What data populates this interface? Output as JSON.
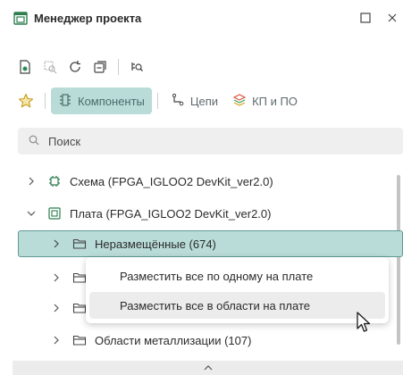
{
  "window": {
    "title": "Менеджер проекта",
    "title_icon": "project-manager-icon",
    "maximize_icon": "maximize-icon",
    "close_icon": "close-icon"
  },
  "toolbar": {
    "icons": [
      "document-settings-icon",
      "select-area-icon",
      "refresh-icon",
      "collapse-all-icon",
      "find-icon"
    ]
  },
  "tabs": {
    "favorites_icon": "star-icon",
    "items": [
      {
        "label": "Компоненты",
        "icon": "component-icon",
        "active": true
      },
      {
        "label": "Цепи",
        "icon": "net-icon",
        "active": false
      },
      {
        "label": "КП и ПО",
        "icon": "pad-layers-icon",
        "active": false
      }
    ]
  },
  "search": {
    "placeholder": "Поиск",
    "value": ""
  },
  "tree": {
    "items": [
      {
        "label": "Схема (FPGA_IGLOO2 DevKit_ver2.0)",
        "icon": "schematic-icon",
        "expanded": false
      },
      {
        "label": "Плата (FPGA_IGLOO2 DevKit_ver2.0)",
        "icon": "board-icon",
        "expanded": true
      },
      {
        "label": "Неразмещённые (674)",
        "icon": "folder-icon",
        "expanded": false,
        "selected": true
      },
      {
        "label": "",
        "icon": "folder-icon",
        "expanded": false
      },
      {
        "label": "",
        "icon": "folder-icon",
        "expanded": false
      },
      {
        "label": "Области металлизации (107)",
        "icon": "folder-icon",
        "expanded": false
      }
    ]
  },
  "context_menu": {
    "items": [
      {
        "label": "Разместить все по одному на плате",
        "hover": false
      },
      {
        "label": "Разместить все в области на плате",
        "hover": true
      }
    ]
  },
  "colors": {
    "accent": "#b9dcd9",
    "accent_border": "#5f9a96",
    "search_bg": "#efefef"
  }
}
